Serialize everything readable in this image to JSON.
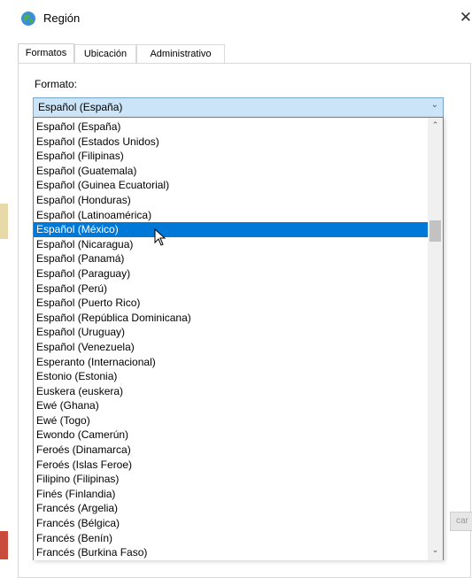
{
  "window": {
    "title": "Región",
    "close_label": "✕"
  },
  "tabs": [
    {
      "label": "Formatos",
      "active": true
    },
    {
      "label": "Ubicación",
      "active": false
    },
    {
      "label": "Administrativo",
      "active": false
    }
  ],
  "format": {
    "label": "Formato:",
    "selected_value": "Español (España)"
  },
  "dropdown": {
    "highlighted_item": "Español (México)",
    "items": [
      "Español (España)",
      "Español (Estados Unidos)",
      "Español (Filipinas)",
      "Español (Guatemala)",
      "Español (Guinea Ecuatorial)",
      "Español (Honduras)",
      "Español (Latinoamérica)",
      "Español (México)",
      "Español (Nicaragua)",
      "Español (Panamá)",
      "Español (Paraguay)",
      "Español (Perú)",
      "Español (Puerto Rico)",
      "Español (República Dominicana)",
      "Español (Uruguay)",
      "Español (Venezuela)",
      "Esperanto (Internacional)",
      "Estonio (Estonia)",
      "Euskera (euskera)",
      "Ewé (Ghana)",
      "Ewé (Togo)",
      "Ewondo (Camerún)",
      "Feroés (Dinamarca)",
      "Feroés (Islas Feroe)",
      "Filipino (Filipinas)",
      "Finés (Finlandia)",
      "Francés (Argelia)",
      "Francés (Bélgica)",
      "Francés (Benín)",
      "Francés (Burkina Faso)"
    ]
  },
  "background_button": {
    "label": "car"
  },
  "colors": {
    "selection": "#0078d7",
    "combo_bg": "#cce4f7",
    "combo_border": "#7aa7d1"
  }
}
